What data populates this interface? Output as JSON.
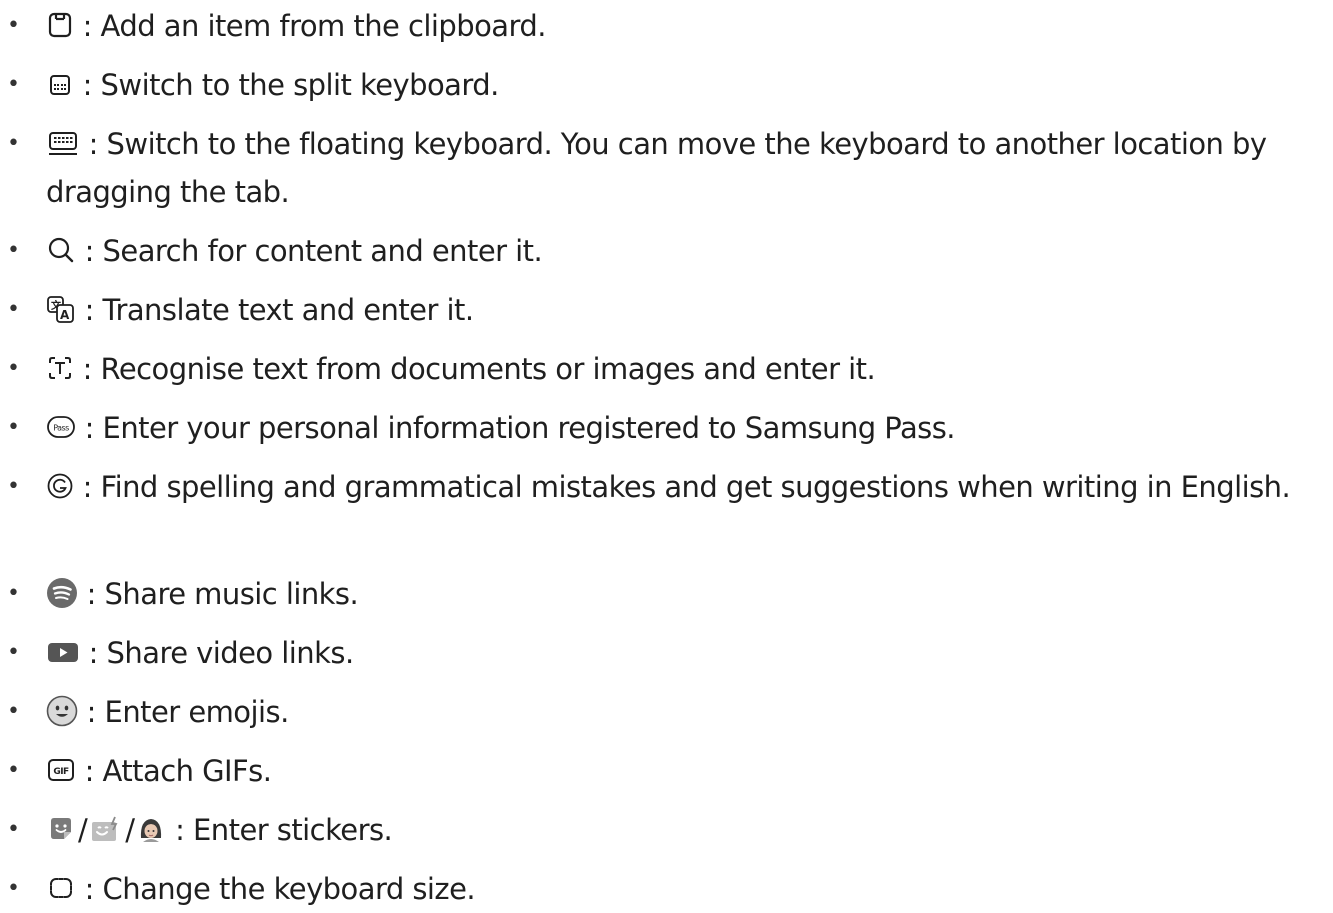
{
  "items": [
    {
      "icon": "clipboard-icon",
      "text": " : Add an item from the clipboard."
    },
    {
      "icon": "split-keyboard-icon",
      "text": " : Switch to the split keyboard."
    },
    {
      "icon": "floating-keyboard-icon",
      "text": " : Switch to the floating keyboard. You can move the keyboard to another location by dragging the tab."
    },
    {
      "icon": "search-icon",
      "text": " : Search for content and enter it."
    },
    {
      "icon": "translate-icon",
      "text": " : Translate text and enter it."
    },
    {
      "icon": "text-recognition-icon",
      "text": " : Recognise text from documents or images and enter it."
    },
    {
      "icon": "samsung-pass-icon",
      "icon_text": "Pass",
      "text": " : Enter your personal information registered to Samsung Pass."
    },
    {
      "icon": "grammar-check-icon",
      "text": " : Find spelling and grammatical mistakes and get suggestions when writing in English."
    },
    {
      "icon": "spotify-icon",
      "text": " : Share music links."
    },
    {
      "icon": "youtube-icon",
      "text": " : Share video links."
    },
    {
      "icon": "emoji-icon",
      "text": " : Enter emojis."
    },
    {
      "icon": "gif-icon",
      "icon_text": "GIF",
      "text": " : Attach GIFs."
    },
    {
      "icons": [
        "sticker-icon",
        "ar-emoji-sticker-icon",
        "avatar-sticker-icon"
      ],
      "separator": "/",
      "text": " : Enter stickers."
    },
    {
      "icon": "keyboard-size-icon",
      "text": " : Change the keyboard size."
    }
  ],
  "colors": {
    "text": "#1f1f1f",
    "icon_dark": "#555555",
    "icon_grey": "#6a6a6a",
    "avatar_skin": "#e8c9b4"
  }
}
